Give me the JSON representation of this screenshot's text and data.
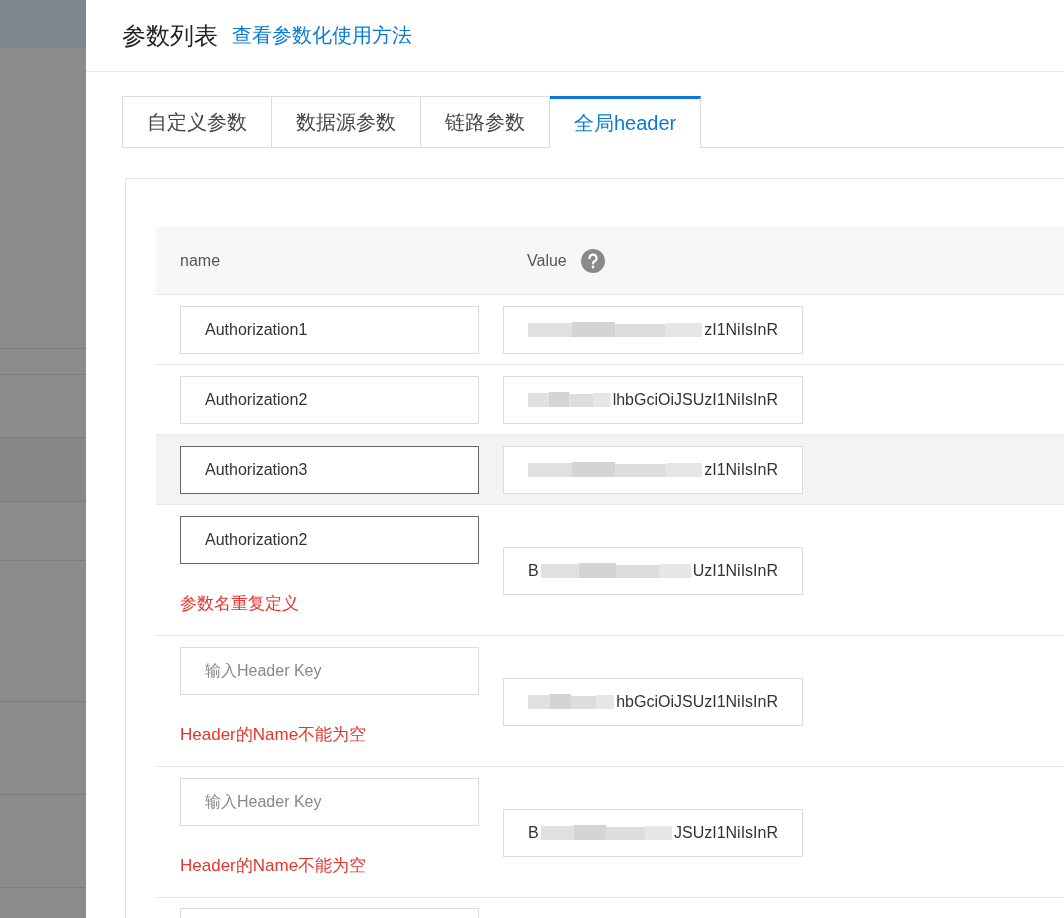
{
  "header": {
    "title": "参数列表",
    "link": "查看参数化使用方法"
  },
  "tabs": [
    {
      "label": "自定义参数",
      "selected": false
    },
    {
      "label": "数据源参数",
      "selected": false
    },
    {
      "label": "链路参数",
      "selected": false
    },
    {
      "label": "全局header",
      "selected": true
    }
  ],
  "table": {
    "columns": [
      {
        "label": "name",
        "help": false
      },
      {
        "label": "Value",
        "help": true
      }
    ],
    "rows": [
      {
        "kind": "entry",
        "hovered": false,
        "name": {
          "value": "Authorization1",
          "active": false
        },
        "value": {
          "suffix": "zI1NiIsInR"
        }
      },
      {
        "kind": "entry",
        "hovered": false,
        "name": {
          "value": "Authorization2",
          "active": false
        },
        "value": {
          "suffix": "lhbGciOiJSUzI1NiIsInR"
        }
      },
      {
        "kind": "entry",
        "hovered": true,
        "name": {
          "value": "Authorization3",
          "active": true
        },
        "value": {
          "suffix": "zI1NiIsInR"
        }
      },
      {
        "kind": "entry",
        "hovered": false,
        "name": {
          "value": "Authorization2",
          "active": true
        },
        "value": {
          "prefix": "B",
          "suffix": "UzI1NiIsInR"
        },
        "error": "参数名重复定义"
      },
      {
        "kind": "entry",
        "hovered": false,
        "name": {
          "placeholder": "输入Header Key",
          "active": false
        },
        "value": {
          "suffix": "hbGciOiJSUzI1NiIsInR"
        },
        "error": "Header的Name不能为空"
      },
      {
        "kind": "entry",
        "hovered": false,
        "name": {
          "placeholder": "输入Header Key",
          "active": false
        },
        "value": {
          "prefix": "B",
          "suffix": "JSUzI1NiIsInR"
        },
        "error": "Header的Name不能为空"
      },
      {
        "kind": "cut_off"
      }
    ]
  }
}
